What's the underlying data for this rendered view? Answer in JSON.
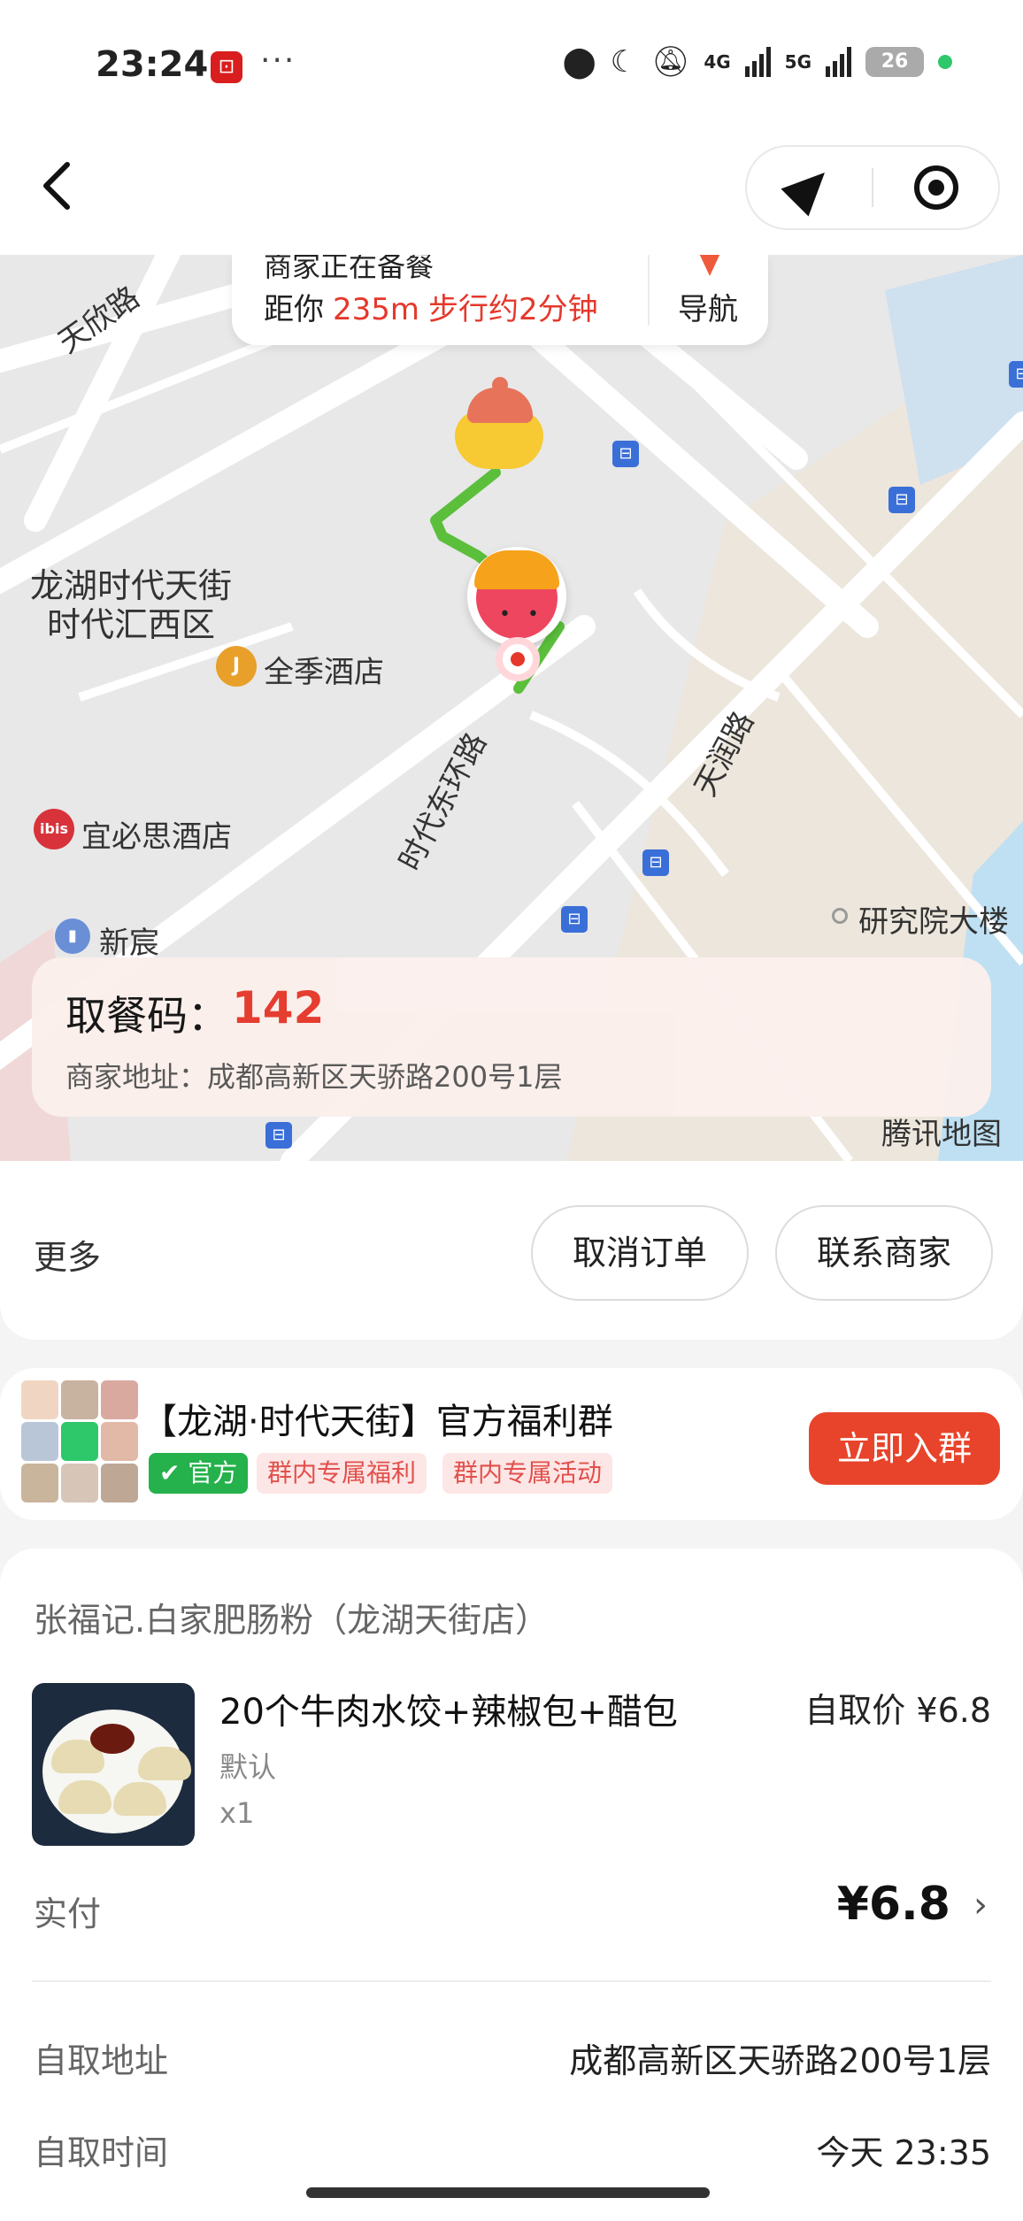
{
  "status_bar": {
    "time": "23:24",
    "dots": "···",
    "network_4g": "4G",
    "network_5g": "5G",
    "battery": "26"
  },
  "nav": {
    "back_icon": "chevron-left-icon",
    "locate_icon": "send-icon",
    "target_icon": "target-icon"
  },
  "map": {
    "merchant_status": "商家正在备餐",
    "distance_prefix": "距你",
    "distance": "235m",
    "walk_time": "步行约2分钟",
    "navigate_label": "导航",
    "labels": {
      "tianxin_road": "天欣路",
      "area_line1": "龙湖时代天街",
      "area_line2": "时代汇西区",
      "ji_hotel": "全季酒店",
      "ibis_hotel": "宜必思酒店",
      "xinchen": "新宸",
      "shidai_east_ring": "时代东环路",
      "tianrun_road": "天润路",
      "research_building": "研究院大楼",
      "map_brand": "腾讯地图",
      "ibis_badge": "ibis",
      "ji_badge": "J"
    },
    "pickup_code_label": "取餐码：",
    "pickup_code": "142",
    "merchant_address_label": "商家地址：",
    "merchant_address": "成都高新区天骄路200号1层"
  },
  "actions": {
    "more": "更多",
    "cancel_order": "取消订单",
    "contact_merchant": "联系商家"
  },
  "group": {
    "title": "【龙湖·时代天街】官方福利群",
    "official_tag": "官方",
    "tag1": "群内专属福利",
    "tag2": "群内专属活动",
    "join_button": "立即入群"
  },
  "order": {
    "store_name": "张福记.白家肥肠粉（龙湖天街店）",
    "item_name": "20个牛肉水饺+辣椒包+醋包",
    "item_spec": "默认",
    "item_qty": "x1",
    "item_price_label": "自取价",
    "item_price": "¥6.8",
    "paid_label": "实付",
    "paid_value": "¥6.8",
    "pickup_address_label": "自取地址",
    "pickup_address": "成都高新区天骄路200号1层",
    "pickup_time_label": "自取时间",
    "pickup_time": "今天 23:35"
  },
  "colors": {
    "accent_red": "#e5382b",
    "join_button": "#e8442b",
    "official_green": "#25b14b",
    "route_green": "#5bbf3c"
  }
}
